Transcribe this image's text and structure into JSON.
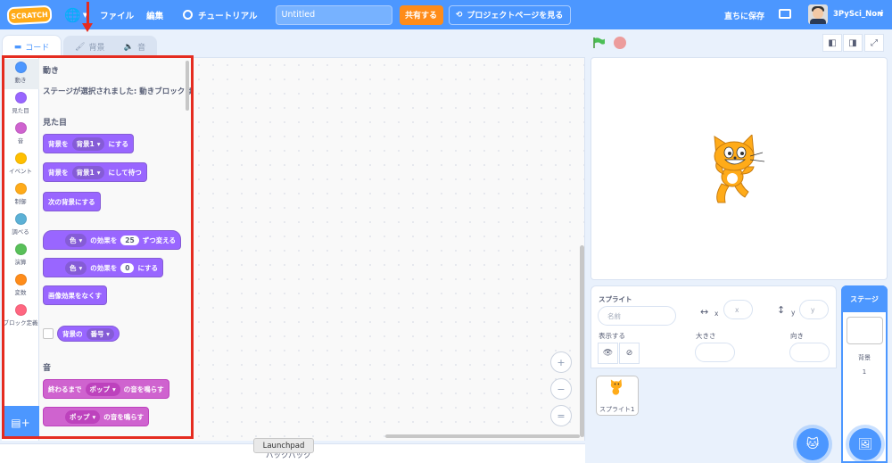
{
  "menubar": {
    "logo": "SCRATCH",
    "file": "ファイル",
    "edit": "編集",
    "tutorials": "チュートリアル",
    "project_title": "Untitled",
    "share": "共有する",
    "see_project_page": "プロジェクトページを見る",
    "save_now": "直ちに保存",
    "username": "3PySci_Nori"
  },
  "tabs": {
    "code": "コード",
    "backdrop": "背景",
    "sound": "音"
  },
  "categories": [
    {
      "label": "動き",
      "color": "#4c97ff"
    },
    {
      "label": "見た目",
      "color": "#9966ff"
    },
    {
      "label": "音",
      "color": "#cf63cf"
    },
    {
      "label": "イベント",
      "color": "#ffbf00"
    },
    {
      "label": "制御",
      "color": "#ffab19"
    },
    {
      "label": "調べる",
      "color": "#5cb1d6"
    },
    {
      "label": "演算",
      "color": "#59c059"
    },
    {
      "label": "変数",
      "color": "#ff8c1a"
    },
    {
      "label": "ブロック定義",
      "color": "#ff6680"
    }
  ],
  "flyout": {
    "motion_heading": "動き",
    "motion_note": "ステージが選択されました: 動きブロックはありません",
    "looks_heading": "見た目",
    "blk1": {
      "pre": "背景を",
      "dd": "背景1",
      "post": "にする"
    },
    "blk2": {
      "pre": "背景を",
      "dd": "背景1",
      "post": "にして待つ"
    },
    "blk3": "次の背景にする",
    "blk4": {
      "dd": "色",
      "mid": "の効果を",
      "num": "25",
      "post": "ずつ変える"
    },
    "blk5": {
      "dd": "色",
      "mid": "の効果を",
      "num": "0",
      "post": "にする"
    },
    "blk6": "画像効果をなくす",
    "reporter": {
      "pre": "背景の",
      "dd": "番号"
    },
    "sound_heading": "音",
    "blk7": {
      "pre": "終わるまで",
      "dd": "ポップ",
      "post": "の音を鳴らす"
    },
    "blk8": {
      "dd": "ポップ",
      "post": "の音を鳴らす"
    }
  },
  "workspace": {
    "zoom_in": "+",
    "zoom_out": "−",
    "reset": "="
  },
  "bottom": {
    "backpack": "バックパック",
    "launchpad": "Launchpad"
  },
  "sprite_info": {
    "sprite_label": "スプライト",
    "name_placeholder": "名前",
    "x_label": "x",
    "x_placeholder": "x",
    "y_label": "y",
    "y_placeholder": "y",
    "show_label": "表示する",
    "size_label": "大きさ",
    "direction_label": "向き",
    "sprite1": "スプライト1"
  },
  "stage_selector": {
    "title": "ステージ",
    "backdrops_label": "背景",
    "backdrops_count": "1"
  },
  "colors": {
    "accent": "#4c97ff",
    "highlight": "#e52c20",
    "share": "#ff8c1a",
    "looks": "#9966ff",
    "sound": "#cf63cf"
  }
}
